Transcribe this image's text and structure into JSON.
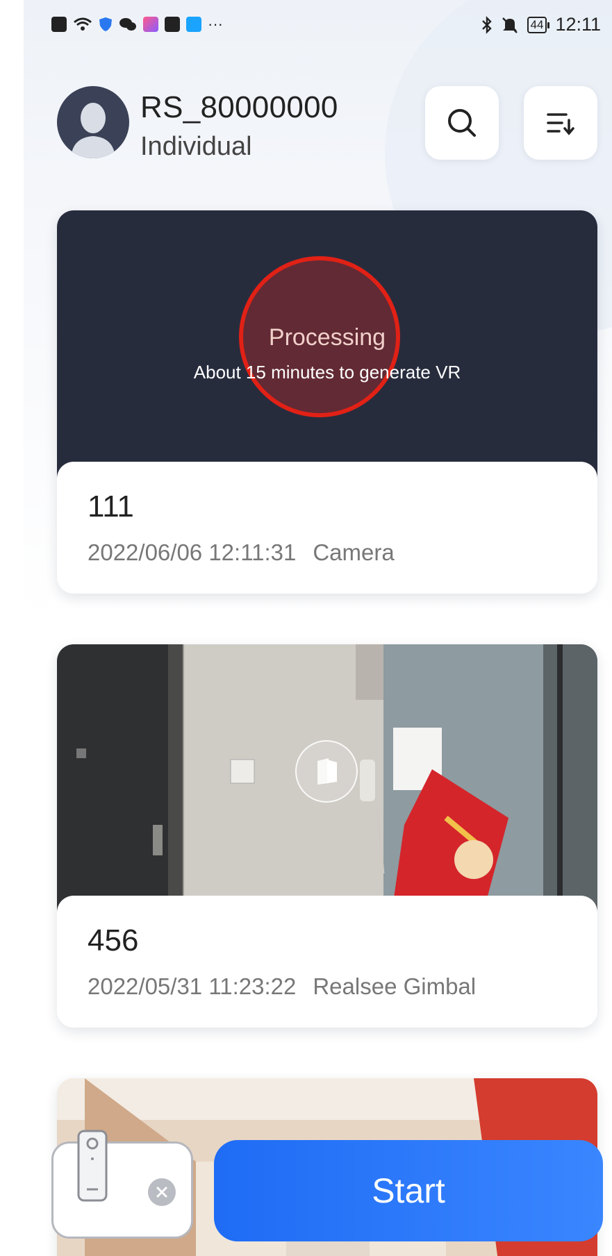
{
  "status_bar": {
    "time": "12:11",
    "battery": "44",
    "more": "···"
  },
  "header": {
    "username": "RS_80000000",
    "account_type": "Individual"
  },
  "cards": [
    {
      "processing_title": "Processing",
      "processing_sub": "About 15 minutes to generate VR",
      "title": "111",
      "date": "2022/06/06 12:11:31",
      "source": "Camera"
    },
    {
      "title": "456",
      "date": "2022/05/31 11:23:22",
      "source": "Realsee Gimbal"
    }
  ],
  "bottom": {
    "start_label": "Start"
  },
  "colors": {
    "accent": "#2f7bff",
    "card_dark": "#272c3d",
    "highlight_ring": "#e12116"
  }
}
